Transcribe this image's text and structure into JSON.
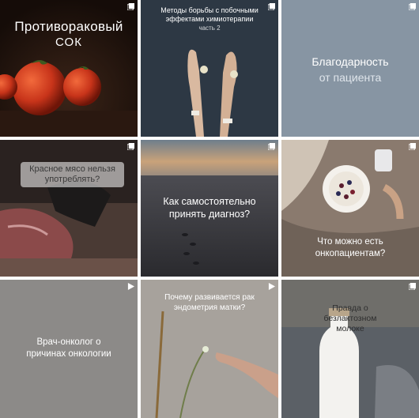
{
  "tiles": [
    {
      "title": "Противораковый",
      "subtitle": "СОК",
      "icon": "multi-photo-icon"
    },
    {
      "title": "Методы борьбы с побочными эффектами химиотерапии",
      "subtitle": "часть 2",
      "icon": "multi-photo-icon"
    },
    {
      "title": "Благодарность",
      "subtitle": "от пациента",
      "icon": "multi-photo-icon"
    },
    {
      "title": "Красное мясо нельзя употреблять?",
      "icon": "multi-photo-icon"
    },
    {
      "title": "Как самостоятельно принять диагноз?",
      "icon": "multi-photo-icon"
    },
    {
      "title": "Что можно есть онкопациентам?",
      "icon": "multi-photo-icon"
    },
    {
      "title": "Врач-онколог о причинах онкологии",
      "icon": "video-icon"
    },
    {
      "title": "Почему развивается рак эндометрия матки?",
      "icon": "video-icon"
    },
    {
      "title": "Правда о безлактозном молоке",
      "icon": "multi-photo-icon"
    }
  ]
}
